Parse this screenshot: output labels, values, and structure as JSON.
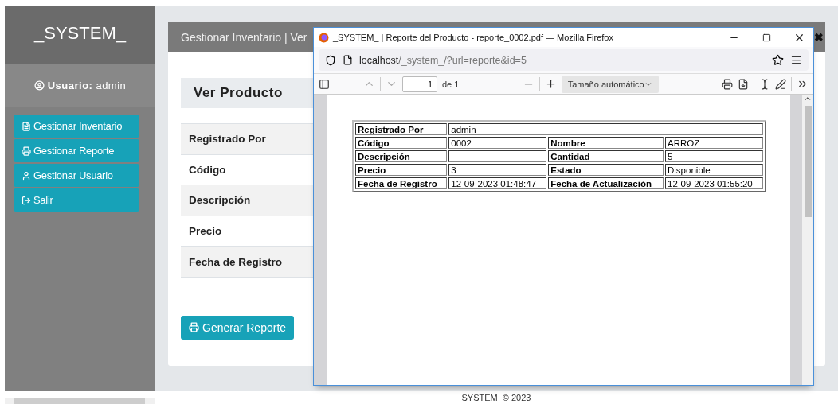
{
  "sidebar": {
    "brand": "_SYSTEM_",
    "user_label": "Usuario:",
    "user_name": "admin",
    "menu": [
      {
        "label": "Gestionar Inventario"
      },
      {
        "label": "Gestionar Reporte"
      },
      {
        "label": "Gestionar Usuario"
      },
      {
        "label": "Salir"
      }
    ]
  },
  "main": {
    "breadcrumb": "Gestionar Inventario | Ver",
    "close": "✖",
    "title": "Ver Producto",
    "fields": [
      "Registrado Por",
      "Código",
      "Descripción",
      "Precio",
      "Fecha de Registro"
    ],
    "button": "Generar Reporte"
  },
  "footer": "SYSTEM  © 2023",
  "browser": {
    "title": "_SYSTEM_ | Reporte del Producto - reporte_0002.pdf — Mozilla Firefox",
    "url_host": "localhost",
    "url_path": "/_system_/?url=reporte&id=5",
    "page": "1",
    "page_total": "de 1",
    "zoom": "Tamaño automático",
    "report": [
      [
        {
          "label": "Registrado Por",
          "value": "admin"
        }
      ],
      [
        {
          "label": "Código",
          "value": "0002"
        },
        {
          "label": "Nombre",
          "value": "ARROZ"
        }
      ],
      [
        {
          "label": "Descripción"
        },
        {
          "label": "Cantidad",
          "value": "5"
        }
      ],
      [
        {
          "label": "Precio",
          "value": "3"
        },
        {
          "label": "Estado",
          "value": "Disponible"
        }
      ],
      [
        {
          "label": "Fecha de Registro",
          "value": "12-09-2023 01:48:47"
        },
        {
          "label": "Fecha de Actualización",
          "value": "12-09-2023 01:55:20"
        }
      ]
    ]
  }
}
